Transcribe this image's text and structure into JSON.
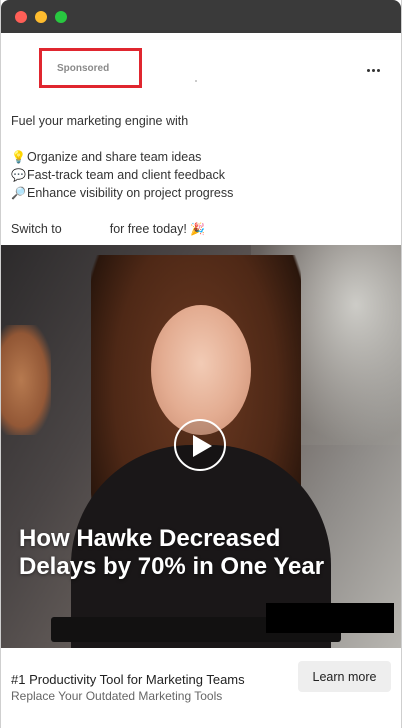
{
  "window": {
    "controls": {
      "close_color": "#ff5f57",
      "minimize_color": "#febc2e",
      "maximize_color": "#28c840"
    }
  },
  "header": {
    "sponsored_label": "Sponsored",
    "more_icon": "more-horizontal-icon"
  },
  "copy": {
    "intro": "Fuel your marketing engine with",
    "features": [
      {
        "icon": "💡",
        "icon_name": "lightbulb-icon",
        "text": "Organize and share team ideas"
      },
      {
        "icon": "💬",
        "icon_name": "speech-bubble-icon",
        "text": "Fast-track team and client feedback"
      },
      {
        "icon": "🔎",
        "icon_name": "magnifier-icon",
        "text": "Enhance visibility on project progress"
      }
    ],
    "cta_prefix": "Switch to",
    "cta_suffix": "for free today!",
    "cta_icon": "🎉",
    "cta_icon_name": "party-popper-icon"
  },
  "video": {
    "headline_line1": "How Hawke Decreased",
    "headline_line2": "Delays by 70% in One Year",
    "play_icon": "play-icon"
  },
  "footer": {
    "title": "#1 Productivity Tool for Marketing Teams",
    "subtitle": "Replace Your Outdated Marketing Tools",
    "button_label": "Learn more"
  }
}
